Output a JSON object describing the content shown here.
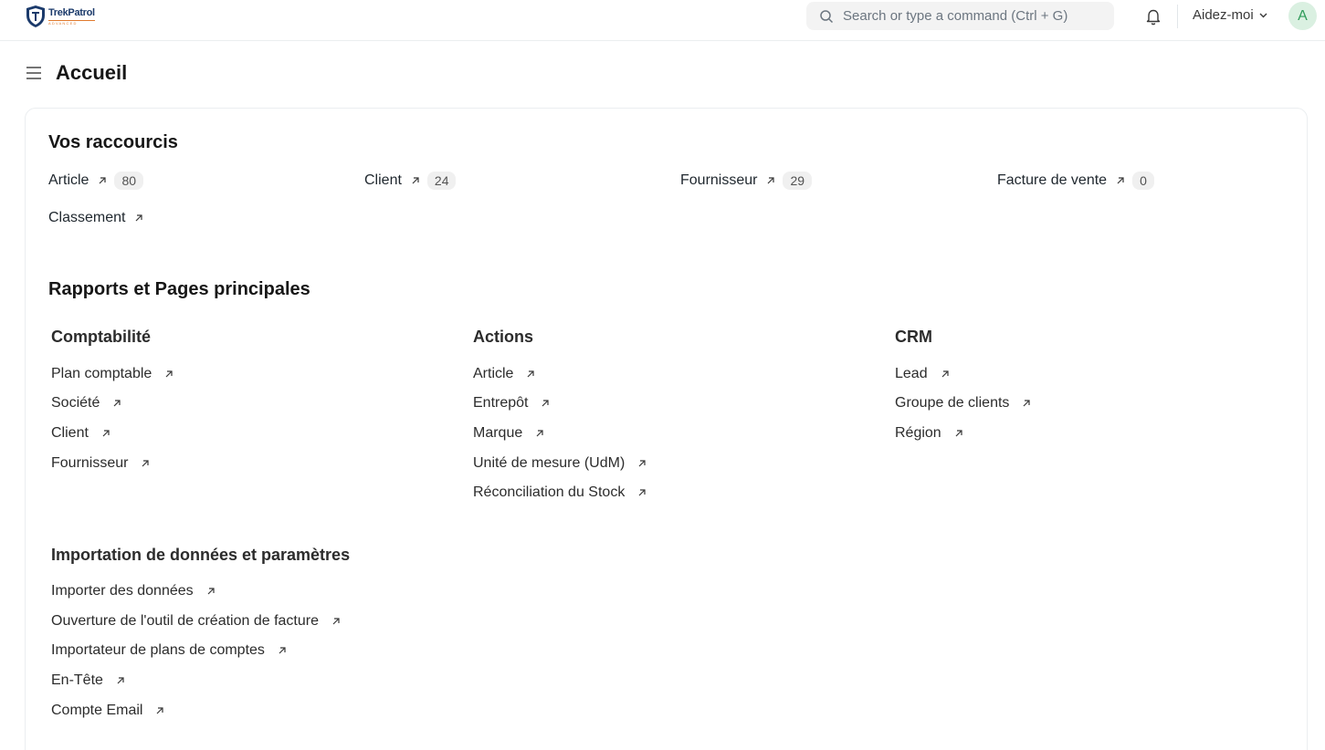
{
  "navbar": {
    "brand_name": "TrekPatrol",
    "brand_tagline": "ADVANCED",
    "search_placeholder": "Search or type a command (Ctrl + G)",
    "help_label": "Aidez-moi",
    "avatar_initial": "A"
  },
  "page": {
    "title": "Accueil"
  },
  "shortcuts": {
    "title": "Vos raccourcis",
    "items": [
      {
        "label": "Article",
        "count": "80"
      },
      {
        "label": "Client",
        "count": "24"
      },
      {
        "label": "Fournisseur",
        "count": "29"
      },
      {
        "label": "Facture de vente",
        "count": "0"
      },
      {
        "label": "Classement"
      }
    ]
  },
  "reports": {
    "title": "Rapports et Pages principales",
    "groups": [
      {
        "title": "Comptabilité",
        "links": [
          "Plan comptable",
          "Société",
          "Client",
          "Fournisseur"
        ]
      },
      {
        "title": "Actions",
        "links": [
          "Article",
          "Entrepôt",
          "Marque",
          "Unité de mesure (UdM)",
          "Réconciliation du Stock"
        ]
      },
      {
        "title": "CRM",
        "links": [
          "Lead",
          "Groupe de clients",
          "Région"
        ]
      },
      {
        "title": "Importation de données et paramètres",
        "links": [
          "Importer des données",
          "Ouverture de l'outil de création de facture",
          "Importateur de plans de comptes",
          "En-Tête",
          "Compte Email"
        ]
      }
    ]
  },
  "colors": {
    "accent": "#2f9c5a",
    "avatar_bg": "#daf0e1",
    "logo_blue": "#1b3a6b",
    "logo_orange": "#e07a2e"
  }
}
